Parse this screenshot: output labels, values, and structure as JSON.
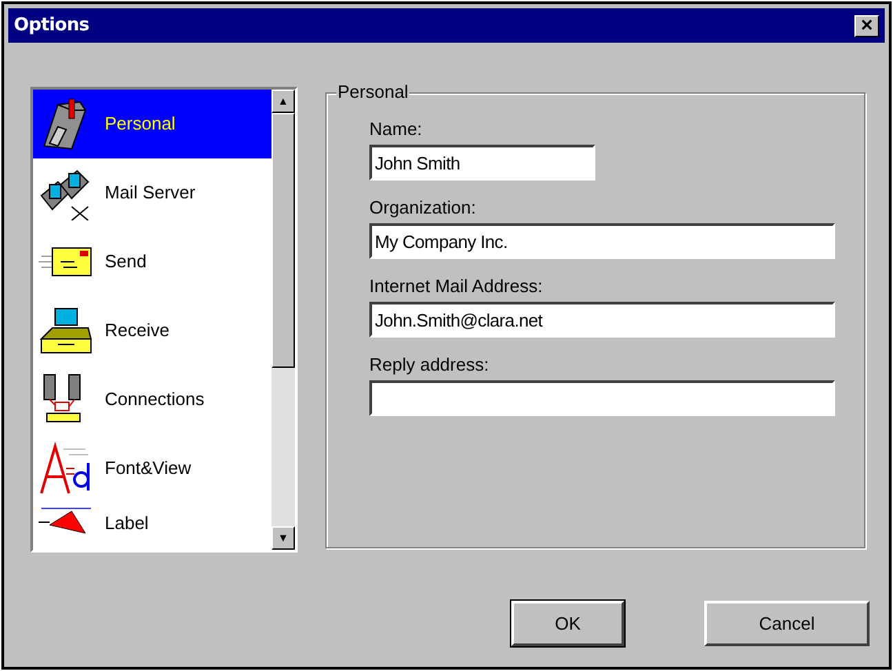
{
  "window": {
    "title": "Options",
    "close": "×"
  },
  "sidebar": {
    "items": [
      {
        "label": "Personal",
        "kind": "mailbox",
        "selected": true
      },
      {
        "label": "Mail Server",
        "kind": "server",
        "selected": false
      },
      {
        "label": "Send",
        "kind": "send",
        "selected": false
      },
      {
        "label": "Receive",
        "kind": "receive",
        "selected": false
      },
      {
        "label": "Connections",
        "kind": "connections",
        "selected": false
      },
      {
        "label": "Font&View",
        "kind": "font",
        "selected": false
      },
      {
        "label": "Label",
        "kind": "label",
        "selected": false
      }
    ],
    "scroll_up": "▲",
    "scroll_down": "▼"
  },
  "group": {
    "title": "Personal",
    "fields": [
      {
        "label": "Name:",
        "value": "John Smith",
        "kind": "short"
      },
      {
        "label": "Organization:",
        "value": "My Company Inc.",
        "kind": "long"
      },
      {
        "label": "Internet Mail Address:",
        "value": "John.Smith@clara.net",
        "kind": "long"
      },
      {
        "label": "Reply address:",
        "kind": "long"
      }
    ]
  },
  "buttons": [
    {
      "label": "OK",
      "default": true
    },
    {
      "label": "Cancel",
      "default": false
    }
  ]
}
